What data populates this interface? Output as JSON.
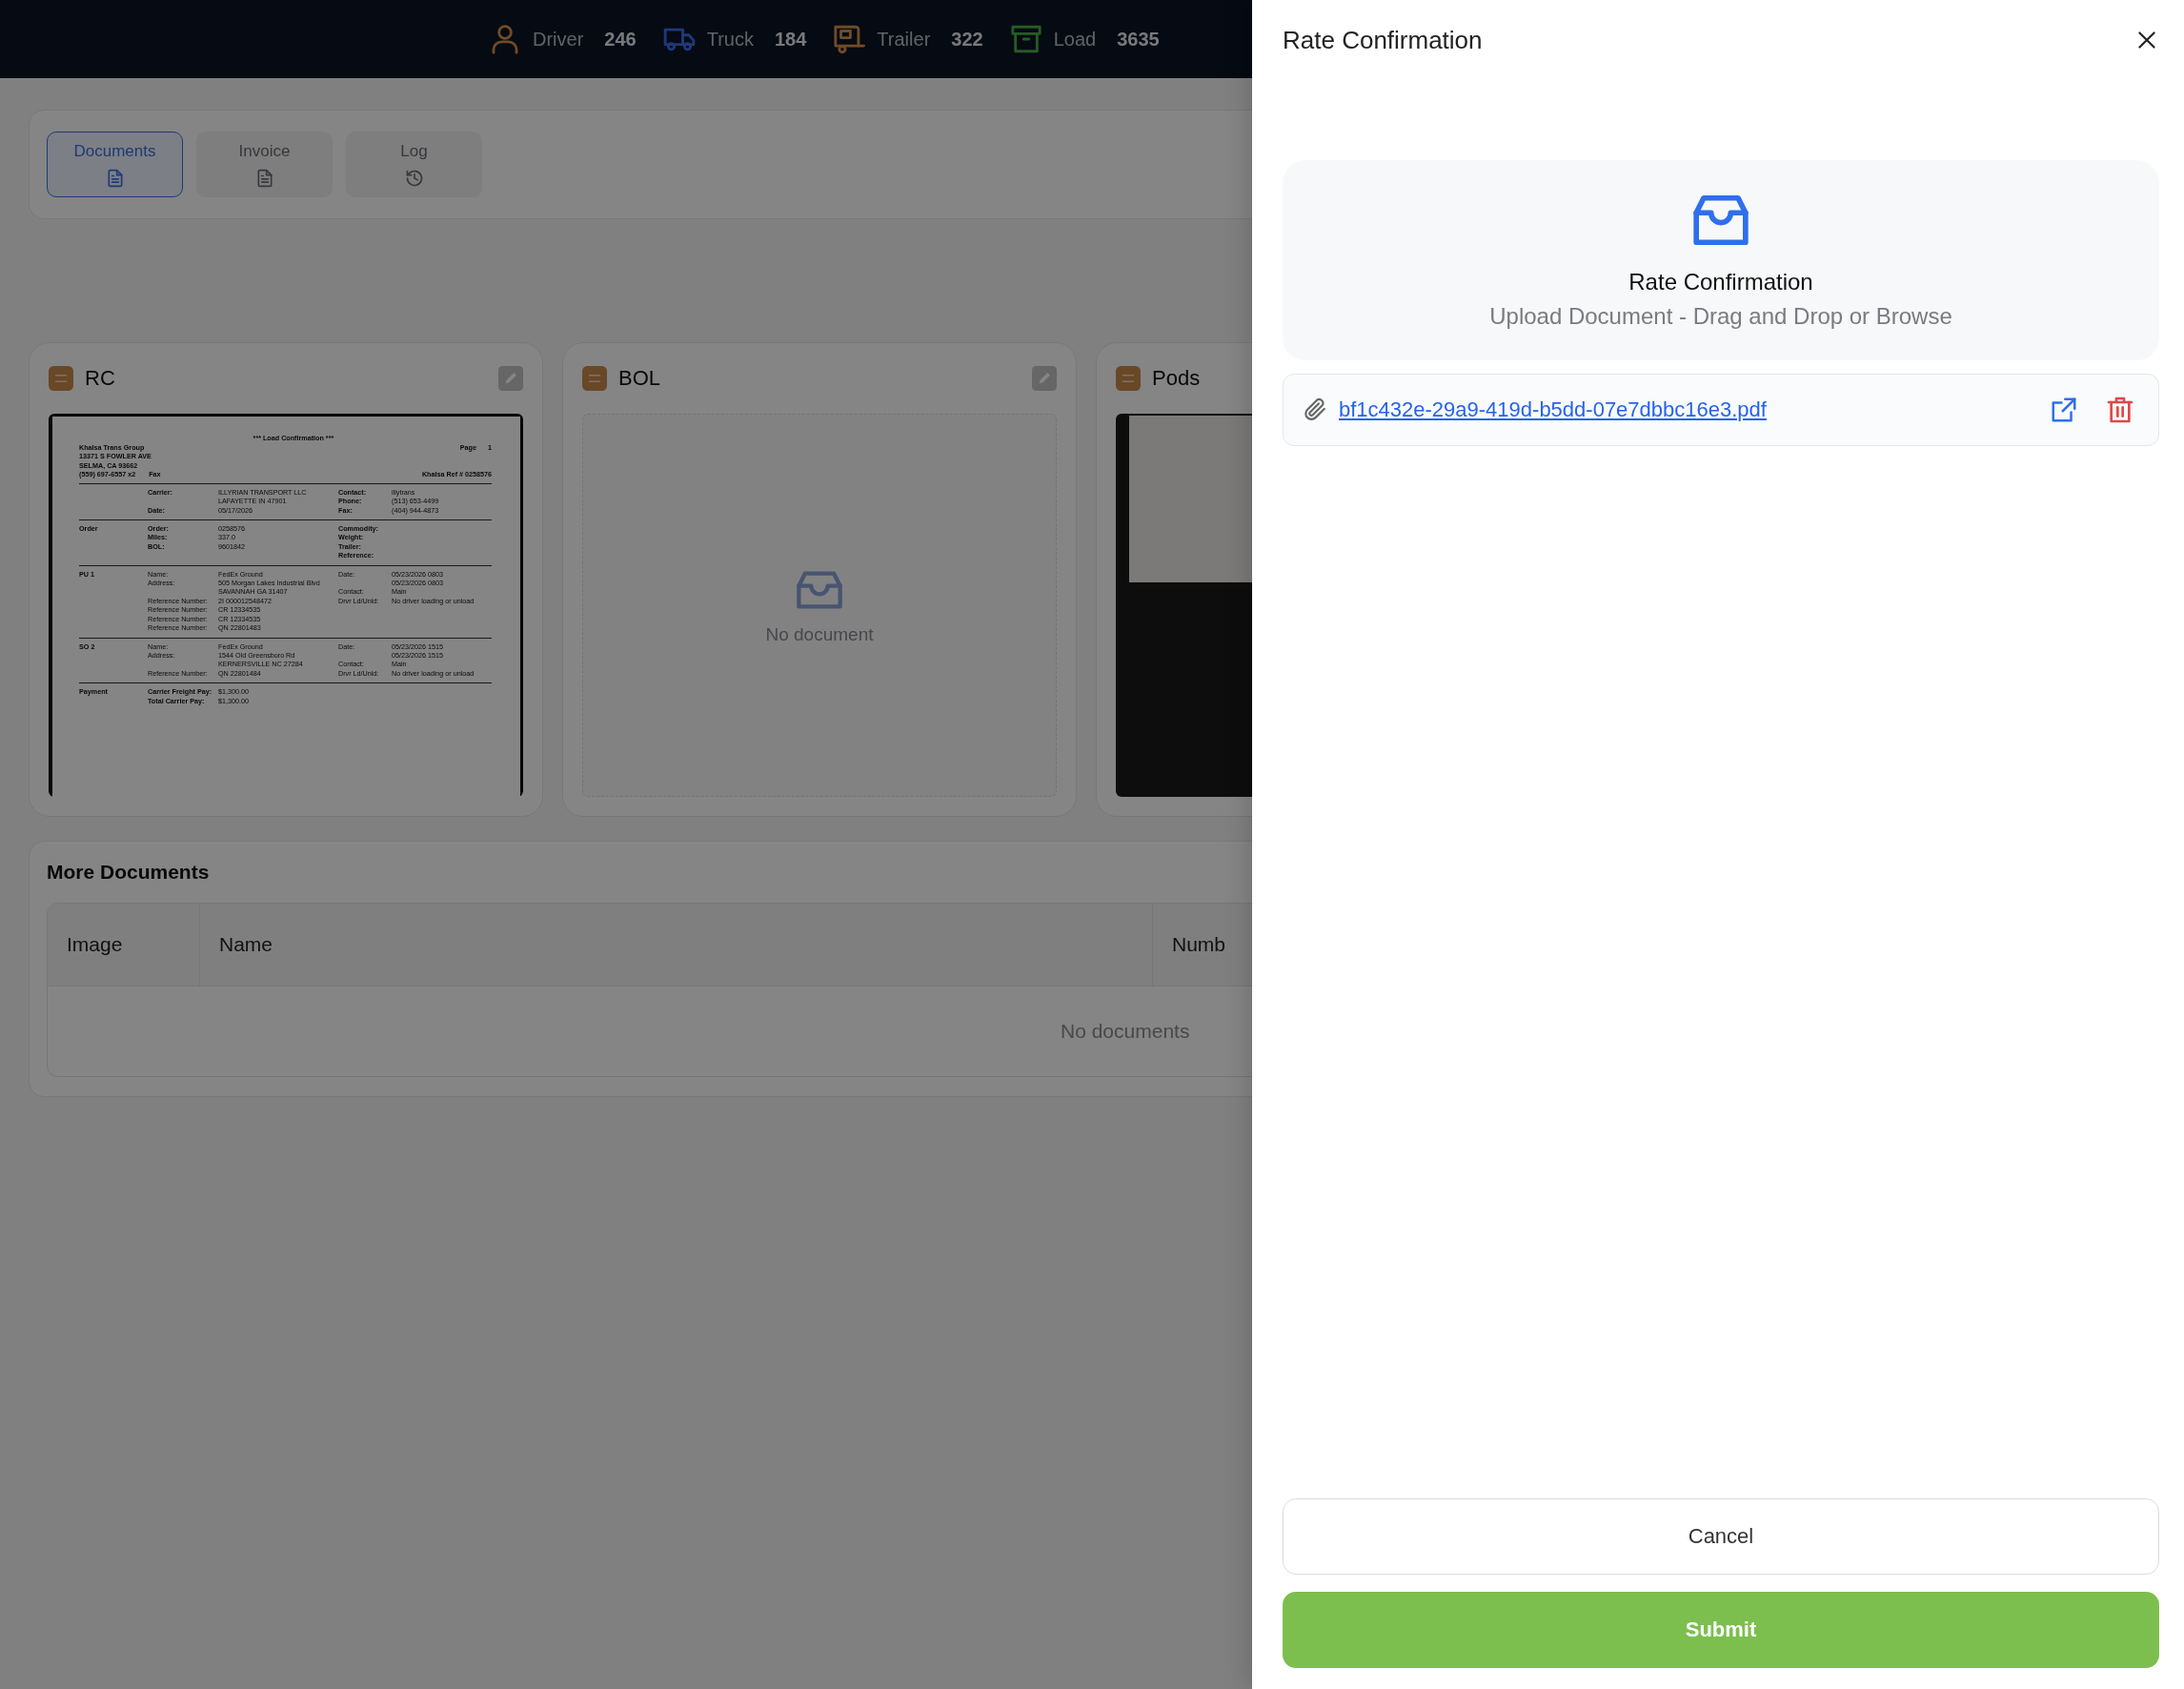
{
  "top_bar": {
    "stats": [
      {
        "kind": "driver",
        "label": "Driver",
        "value": "246"
      },
      {
        "kind": "truck",
        "label": "Truck",
        "value": "184"
      },
      {
        "kind": "trailer",
        "label": "Trailer",
        "value": "322"
      },
      {
        "kind": "load",
        "label": "Load",
        "value": "3635"
      }
    ]
  },
  "tabs": [
    {
      "label": "Documents",
      "selected": true
    },
    {
      "label": "Invoice",
      "selected": false
    },
    {
      "label": "Log",
      "selected": false
    }
  ],
  "document_cards": [
    {
      "title": "RC",
      "kind": "preview",
      "editable": true,
      "document": {
        "heading": "*** Load Confirmation ***",
        "company": [
          "Khalsa Trans Group",
          "13371 S FOWLER AVE",
          "SELMA, CA 93662"
        ],
        "phone": "(559) 697-6557 x2",
        "fax_label": "Fax",
        "page_label": "Page",
        "page": "1",
        "ref": "Khalsa Ref # 0258576",
        "sections": [
          {
            "bold_labels": true,
            "left": [
              {
                "label": "Carrier:",
                "values": [
                  "ILLYRIAN TRANSPORT LLC",
                  "LAFAYETTE IN 47901"
                ]
              },
              {
                "label": "Date:",
                "values": [
                  "05/17/2026"
                ]
              }
            ],
            "right": [
              {
                "label": "Contact:",
                "values": [
                  "illytrans"
                ]
              },
              {
                "label": "Phone:",
                "values": [
                  "(513) 653-4499"
                ]
              },
              {
                "label": "Fax:",
                "values": [
                  "(404) 944-4873"
                ]
              }
            ]
          },
          {
            "label": "Order",
            "bold_labels": true,
            "left": [
              {
                "label": "Order:",
                "values": [
                  "0258576"
                ]
              },
              {
                "label": "Miles:",
                "values": [
                  "337.0"
                ]
              },
              {
                "label": "BOL:",
                "values": [
                  "9601842"
                ]
              }
            ],
            "right": [
              {
                "label": "Commodity:"
              },
              {
                "label": "Weight:"
              },
              {
                "label": "Trailer:"
              },
              {
                "label": "Reference:"
              }
            ]
          },
          {
            "label": "PU 1",
            "bold_labels": false,
            "left": [
              {
                "label": "Name:",
                "values": [
                  "FedEx Ground"
                ]
              },
              {
                "label": "Address:",
                "values": [
                  "505 Morgan Lakes Industrial Blvd",
                  "SAVANNAH GA 31407"
                ]
              },
              {
                "label": "Reference Number:",
                "values": [
                  "2I 000012548472"
                ]
              },
              {
                "label": "Reference Number:",
                "values": [
                  "CR 12334535"
                ]
              },
              {
                "label": "Reference Number:",
                "values": [
                  "CR 12334535"
                ]
              },
              {
                "label": "Reference Number:",
                "values": [
                  "QN 22801483"
                ]
              }
            ],
            "right": [
              {
                "label": "Date:",
                "values": [
                  "05/23/2026 0803",
                  "05/23/2026 0803"
                ]
              },
              {
                "label": "Contact:",
                "values": [
                  "Main"
                ]
              },
              {
                "label": "Drvr Ld/Unld:",
                "values": [
                  "No driver loading or unload"
                ]
              }
            ]
          },
          {
            "label": "SO 2",
            "bold_labels": false,
            "left": [
              {
                "label": "Name:",
                "values": [
                  "FedEx Ground"
                ]
              },
              {
                "label": "Address:",
                "values": [
                  "1544 Old Greensboro Rd",
                  "KERNERSVILLE NC 27284"
                ]
              },
              {
                "label": "Reference Number:",
                "values": [
                  "QN 22801484"
                ]
              }
            ],
            "right": [
              {
                "label": "Date:",
                "values": [
                  "05/23/2026 1515",
                  "05/23/2026 1515"
                ]
              },
              {
                "label": "Contact:",
                "values": [
                  "Main"
                ]
              },
              {
                "label": "Drvr Ld/Unld:",
                "values": [
                  "No driver loading or unload"
                ]
              }
            ]
          },
          {
            "label": "Payment",
            "bold_labels": true,
            "left": [
              {
                "label": "Carrier Freight Pay:",
                "values": [
                  "$1,300.00"
                ]
              },
              {
                "label": "Total Carrier Pay:",
                "values": [
                  "$1,300.00"
                ]
              }
            ]
          }
        ]
      }
    },
    {
      "title": "BOL",
      "kind": "empty",
      "editable": true,
      "empty_text": "No document"
    },
    {
      "title": "Pods",
      "kind": "scan",
      "editable": false
    }
  ],
  "more_documents": {
    "title": "More Documents",
    "columns": [
      "Image",
      "Name",
      "Numb"
    ],
    "empty_text": "No documents"
  },
  "drawer": {
    "title": "Rate Confirmation",
    "upload": {
      "title": "Rate Confirmation",
      "hint": "Upload Document - Drag and Drop or Browse"
    },
    "files": [
      {
        "name": "bf1c432e-29a9-419d-b5dd-07e7dbbc16e3.pdf"
      }
    ],
    "buttons": [
      {
        "label": "Cancel",
        "kind": "secondary"
      },
      {
        "label": "Submit",
        "kind": "primary"
      }
    ]
  }
}
